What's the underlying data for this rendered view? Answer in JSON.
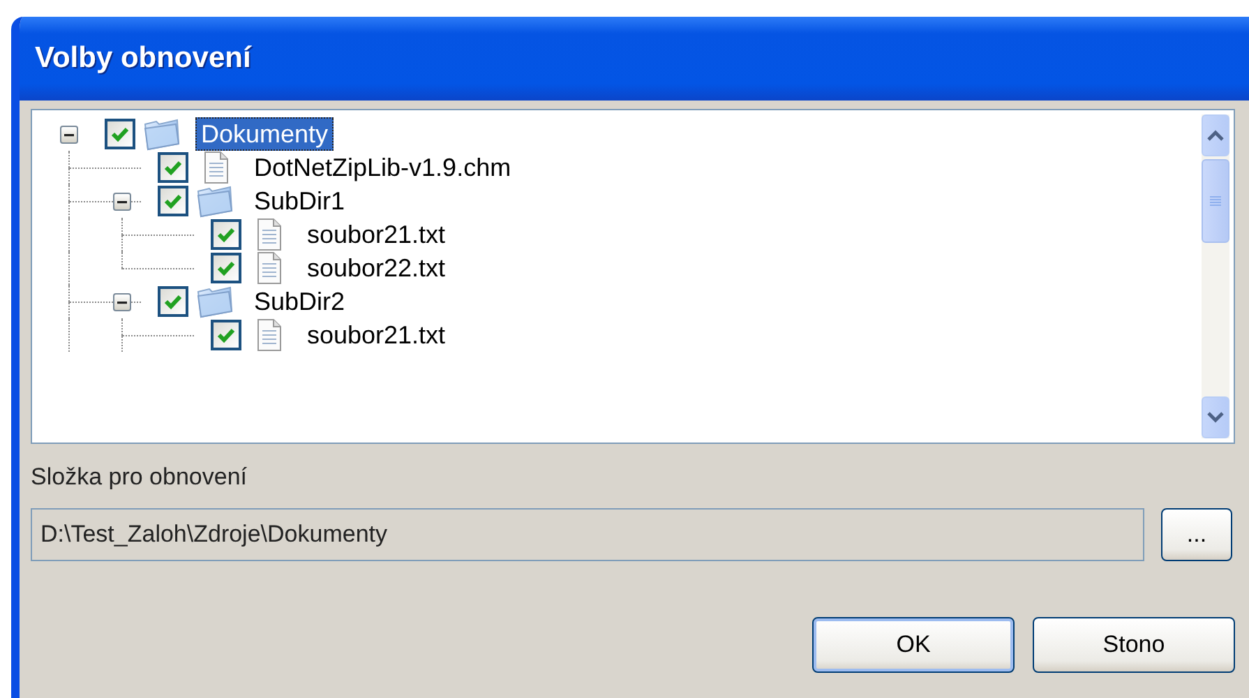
{
  "window": {
    "title": "Volby obnovení"
  },
  "tree": [
    {
      "kind": "folder",
      "label": "Dokumenty",
      "checked": true,
      "selected": true,
      "expanded": true,
      "children": [
        {
          "kind": "file",
          "label": "DotNetZipLib-v1.9.chm",
          "checked": true,
          "selected": false
        },
        {
          "kind": "folder",
          "label": "SubDir1",
          "checked": true,
          "selected": false,
          "expanded": true,
          "children": [
            {
              "kind": "file",
              "label": "soubor21.txt",
              "checked": true,
              "selected": false
            },
            {
              "kind": "file",
              "label": "soubor22.txt",
              "checked": true,
              "selected": false
            }
          ]
        },
        {
          "kind": "folder",
          "label": "SubDir2",
          "checked": true,
          "selected": false,
          "expanded": true,
          "children": [
            {
              "kind": "file",
              "label": "soubor21.txt",
              "checked": true,
              "selected": false
            }
          ]
        }
      ]
    }
  ],
  "folder_label": "Složka pro obnovení",
  "folder_field": {
    "value": "D:\\Test_Zaloh\\Zdroje\\Dokumenty"
  },
  "browse_button": "...",
  "buttons": [
    "OK",
    "Stono"
  ]
}
